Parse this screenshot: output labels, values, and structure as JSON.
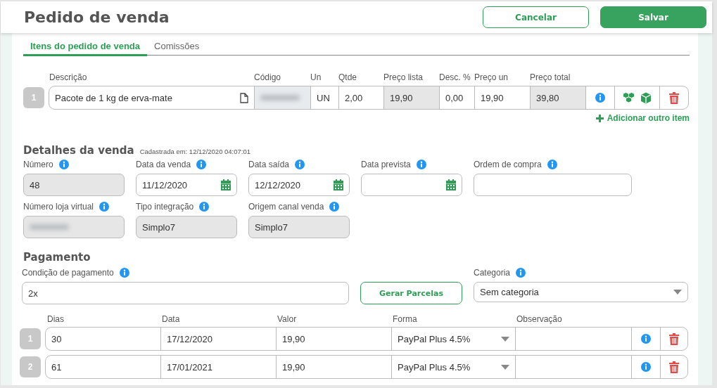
{
  "header": {
    "title": "Pedido de venda",
    "buttons": [
      {
        "label": "Cancelar",
        "kind": "secondary"
      },
      {
        "label": "Salvar",
        "kind": "primary"
      }
    ]
  },
  "tabs": [
    {
      "label": "Itens do pedido de venda",
      "selected": true
    },
    {
      "label": "Comissões",
      "selected": false
    }
  ],
  "items": {
    "columns": [
      "Descrição",
      "Código",
      "Un",
      "Qtde",
      "Preço lista",
      "Desc. %",
      "Preço un",
      "Preço total"
    ],
    "rows": [
      {
        "index": "1",
        "description": "Pacote de 1 kg de erva-mate",
        "unit": "UN",
        "quantity": "2,00",
        "list_price": "19,90",
        "discount": "0,00",
        "unit_price": "19,90",
        "total": "39,80"
      }
    ],
    "add_link": "Adicionar outro item"
  },
  "sale_details": {
    "title": "Detalhes da venda",
    "registered": "Cadastrada em: 12/12/2020 04:07:01",
    "fields": [
      {
        "label": "Número",
        "value": "48",
        "kind": "readonly"
      },
      {
        "label": "Data da venda",
        "value": "11/12/2020",
        "kind": "date"
      },
      {
        "label": "Data saída",
        "value": "12/12/2020",
        "kind": "date"
      },
      {
        "label": "Data prevista",
        "kind": "date"
      },
      {
        "label": "Ordem de compra",
        "kind": "text"
      },
      {
        "label": "Número loja virtual",
        "kind": "redacted"
      },
      {
        "label": "Tipo integração",
        "value": "Simplo7",
        "kind": "readonly"
      },
      {
        "label": "Origem canal venda",
        "value": "Simplo7",
        "kind": "readonly"
      }
    ]
  },
  "payment": {
    "title": "Pagamento",
    "condition": {
      "label": "Condição de pagamento",
      "value": "2x"
    },
    "generate_button": "Gerar Parcelas",
    "category": {
      "label": "Categoria",
      "value": "Sem categoria"
    },
    "columns": [
      "Dias",
      "Data",
      "Valor",
      "Forma",
      "Observação"
    ],
    "installments": [
      {
        "index": "1",
        "days": "30",
        "date": "17/12/2020",
        "amount": "19,90",
        "method": "PayPal Plus 4.5%"
      },
      {
        "index": "2",
        "days": "61",
        "date": "17/01/2021",
        "amount": "19,90",
        "method": "PayPal Plus 4.5%"
      }
    ]
  }
}
